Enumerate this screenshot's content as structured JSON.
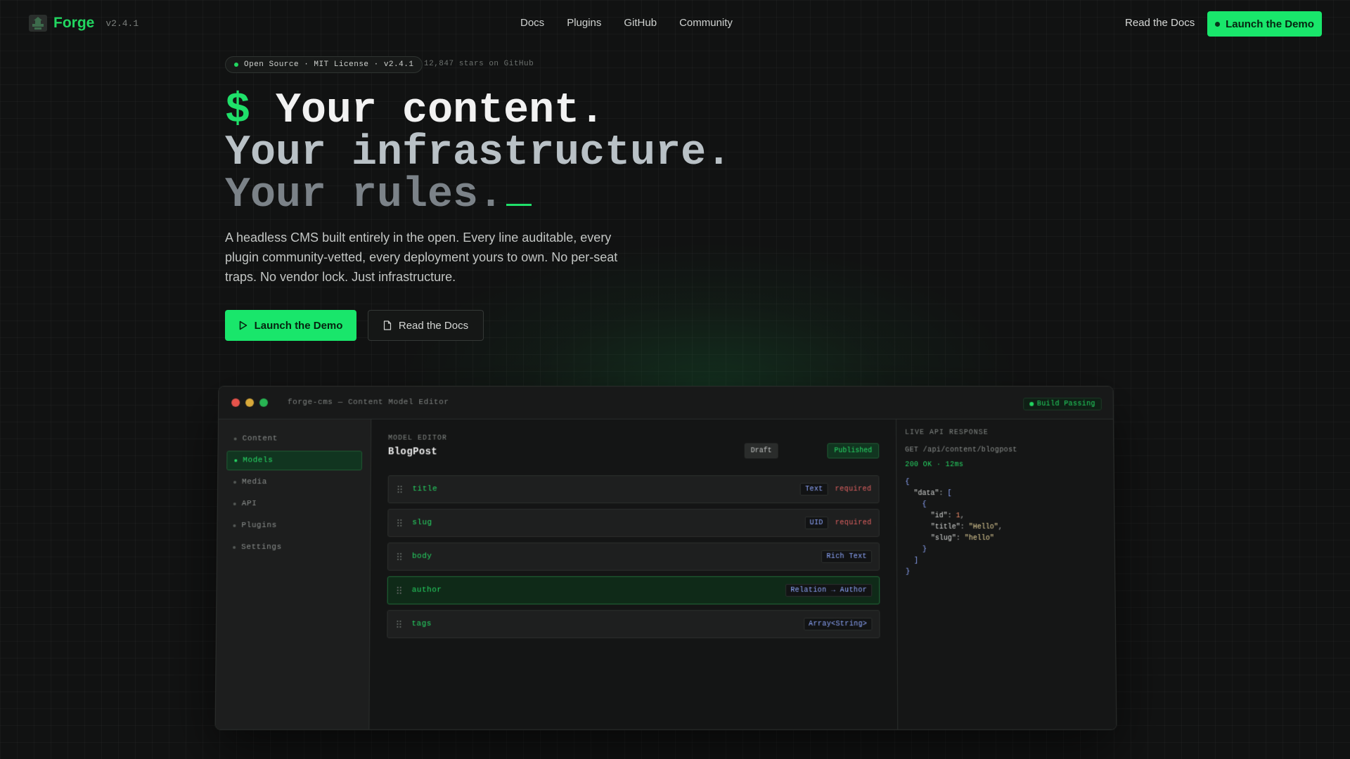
{
  "nav": {
    "brand": "Forge",
    "version": "v2.4.1",
    "links": [
      "Docs",
      "Plugins",
      "GitHub",
      "Community"
    ],
    "read_docs": "Read the Docs",
    "launch": "Launch the Demo"
  },
  "hero": {
    "badge": "Open Source · MIT License · v2.4.1",
    "stars": "12,847 stars on GitHub",
    "line1_prefix": "$",
    "line1": "Your content.",
    "line2": "Your infrastructure.",
    "line3": "Your rules.",
    "description": "A headless CMS built entirely in the open. Every line auditable, every plugin community-vetted, every deployment yours to own. No per-seat traps. No vendor lock. Just infrastructure.",
    "cta_primary": "Launch the Demo",
    "cta_secondary": "Read the Docs"
  },
  "window": {
    "title": "forge-cms — Content Model Editor",
    "build_status": "Build Passing",
    "sidebar": [
      "Content",
      "Models",
      "Media",
      "API",
      "Plugins",
      "Settings"
    ],
    "active_sidebar": "Models",
    "editor": {
      "label": "MODEL EDITOR",
      "title": "BlogPost",
      "status_draft": "Draft",
      "status_published": "Published",
      "fields": [
        {
          "name": "title",
          "type": "Text",
          "required": "required"
        },
        {
          "name": "slug",
          "type": "UID",
          "required": "required"
        },
        {
          "name": "body",
          "type": "Rich Text",
          "required": ""
        },
        {
          "name": "author",
          "type": "Relation → Author",
          "required": ""
        },
        {
          "name": "tags",
          "type": "Array<String>",
          "required": ""
        }
      ],
      "highlighted_field": "author"
    },
    "api": {
      "label": "LIVE API RESPONSE",
      "request": "GET /api/content/blogpost",
      "status": "200 OK · 12ms",
      "json_data_key": "\"data\"",
      "json_id_key": "\"id\"",
      "json_id_value": "1",
      "json_title_key": "\"title\"",
      "json_title_value": "\"Hello\"",
      "json_slug_key": "\"slug\"",
      "json_slug_value": "\"hello\""
    }
  },
  "colors": {
    "accent": "#19e66b",
    "background": "#111212",
    "error": "#e06060",
    "type_chip": "#8fa8ff"
  }
}
